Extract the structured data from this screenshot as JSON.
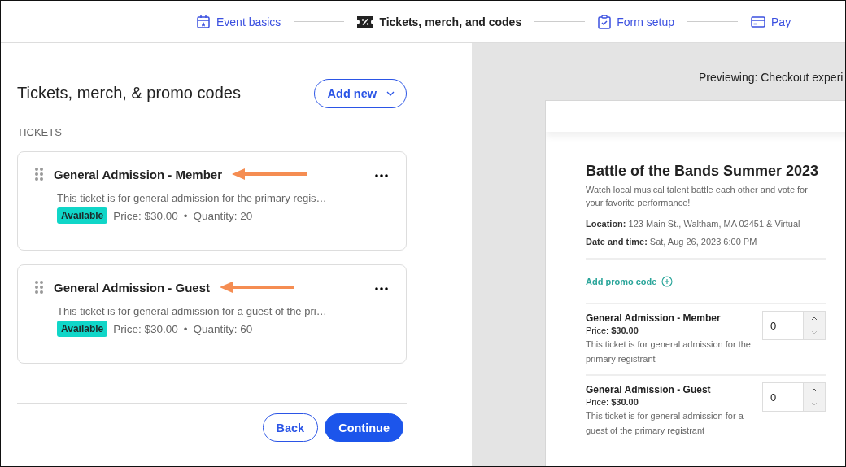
{
  "steps": [
    {
      "label": "Event basics",
      "kind": "calendar",
      "selected": false
    },
    {
      "label": "Tickets, merch, and codes",
      "kind": "ticket",
      "selected": true
    },
    {
      "label": "Form setup",
      "kind": "clipboard",
      "selected": false
    },
    {
      "label": "Pay",
      "kind": "card",
      "selected": false
    }
  ],
  "editor": {
    "title": "Tickets, merch, & promo codes",
    "add_button": "Add new",
    "section_label": "TICKETS",
    "tickets": [
      {
        "name": "General Admission - Member",
        "description": "This ticket is for general admission for the primary regis…",
        "status": "Available",
        "price": "Price: $30.00",
        "separator": "•",
        "quantity": "Quantity: 20",
        "arrow": true
      },
      {
        "name": "General Admission - Guest",
        "description": "This ticket is for general admission for a guest of the pri…",
        "status": "Available",
        "price": "Price: $30.00",
        "separator": "•",
        "quantity": "Quantity: 60",
        "arrow": true
      }
    ],
    "buttons": [
      {
        "label": "Back",
        "kind": "secondary"
      },
      {
        "label": "Continue",
        "kind": "primary"
      }
    ]
  },
  "preview": {
    "heading": "Previewing: Checkout experi",
    "event_title": "Battle of the Bands Summer 2023",
    "event_description": "Watch local musical talent battle each other and vote for your favorite performance!",
    "location": "**Location:** 123 Main St., Waltham, MA 02451 & Virtual",
    "date": "**Date and time:** Sat, Aug 26, 2023 6:00 PM",
    "promo_link": "Add promo code",
    "tickets": [
      {
        "name": "General Admission - Member",
        "price": "Price: **$30.00**",
        "description": "This ticket is for general admission for the primary registrant",
        "quantity": "0"
      },
      {
        "name": "General Admission - Guest",
        "price": "Price: **$30.00**",
        "description": "This ticket is for general admission for a guest of the primary registrant",
        "quantity": "0"
      }
    ]
  }
}
